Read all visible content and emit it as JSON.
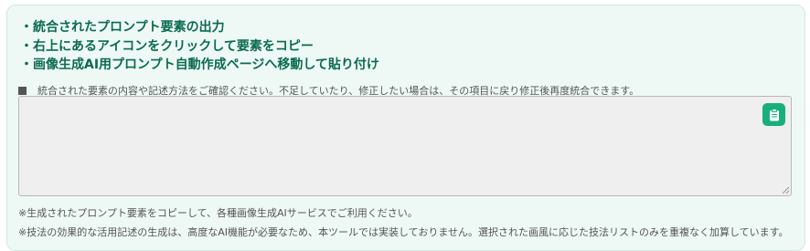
{
  "instructions": [
    "統合されたプロンプト要素の出力",
    "右上にあるアイコンをクリックして要素をコピー",
    "画像生成AI用プロンプト自動作成ページへ移動して貼り付け"
  ],
  "confirm_text": "統合された要素の内容や記述方法をご確認ください。不足していたり、修正したい場合は、その項目に戻り修正後再度統合できます。",
  "output": {
    "value": ""
  },
  "copy_button": {
    "icon": "clipboard-icon",
    "color": "#17b07d"
  },
  "notes": [
    "※生成されたプロンプト要素をコピーして、各種画像生成AIサービスでご利用ください。",
    "※技法の効果的な活用記述の生成は、高度なAI機能が必要なため、本ツールでは実装しておりません。選択された画風に応じた技法リストのみを重複なく加算しています。"
  ]
}
